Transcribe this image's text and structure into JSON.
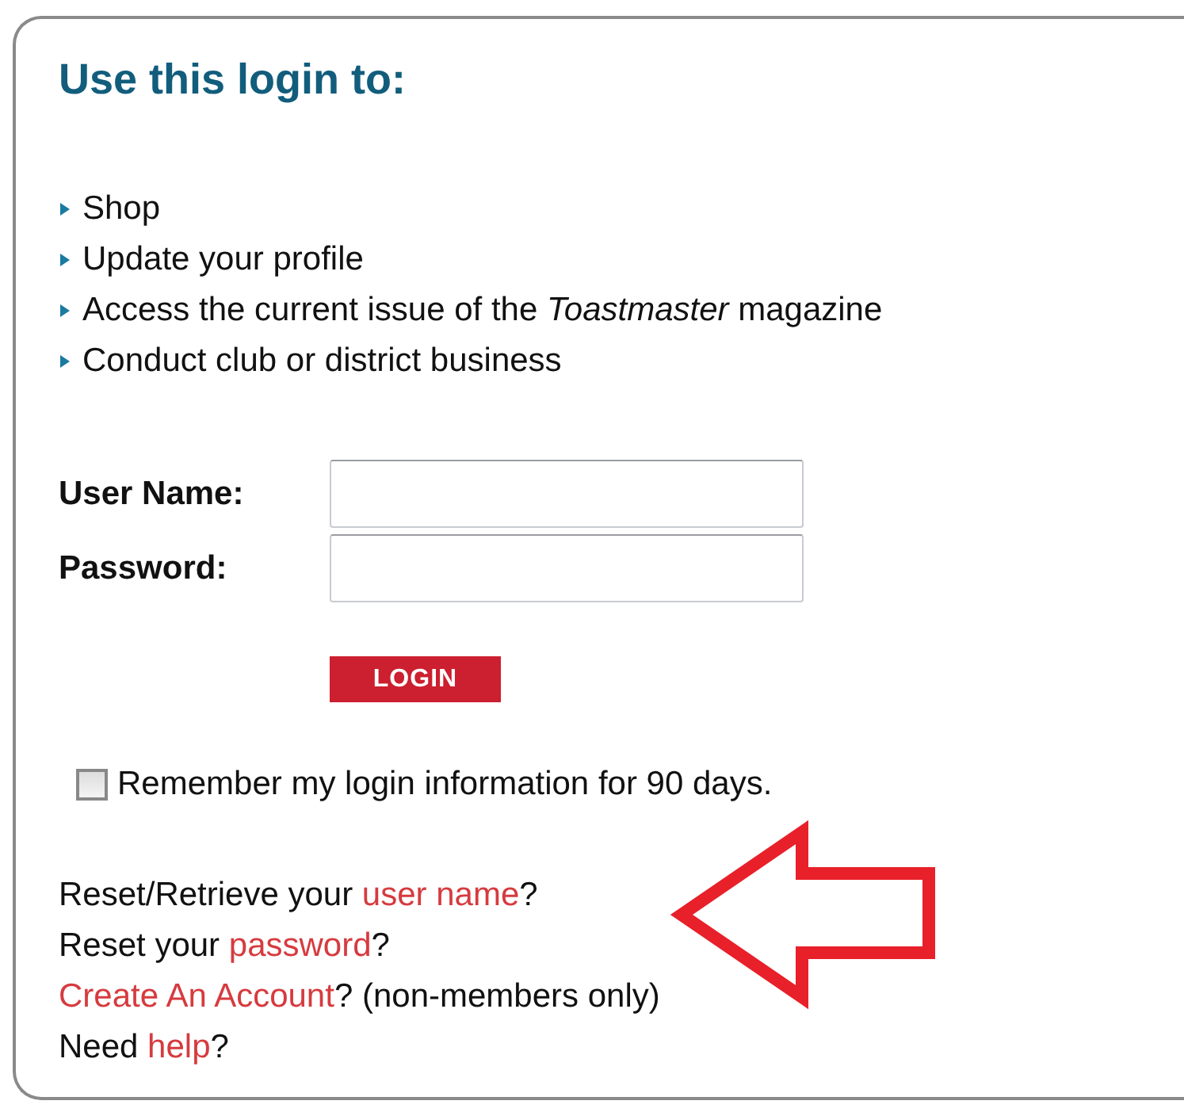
{
  "heading": "Use this login to:",
  "uses": [
    "Shop",
    "Update your profile",
    "Access the current issue of the *Toastmaster* magazine",
    "Conduct club or district business"
  ],
  "fields": [
    {
      "label": "User Name:"
    },
    {
      "label": "Password:"
    }
  ],
  "login_button": "LOGIN",
  "remember": {
    "label": "Remember my login information for 90 days.",
    "checked": false
  },
  "help_lines": [
    {
      "parts": [
        {
          "kind": "text",
          "text": "Reset/Retrieve your "
        },
        {
          "kind": "link",
          "text": "user name"
        },
        {
          "kind": "text",
          "text": "?"
        }
      ]
    },
    {
      "parts": [
        {
          "kind": "text",
          "text": "Reset your "
        },
        {
          "kind": "link",
          "text": "password"
        },
        {
          "kind": "text",
          "text": "?"
        }
      ]
    },
    {
      "parts": [
        {
          "kind": "link",
          "text": "Create An Account"
        },
        {
          "kind": "text",
          "text": "? (non-members only)"
        }
      ]
    },
    {
      "parts": [
        {
          "kind": "text",
          "text": "Need "
        },
        {
          "kind": "link",
          "text": "help"
        },
        {
          "kind": "text",
          "text": "?"
        }
      ]
    }
  ]
}
